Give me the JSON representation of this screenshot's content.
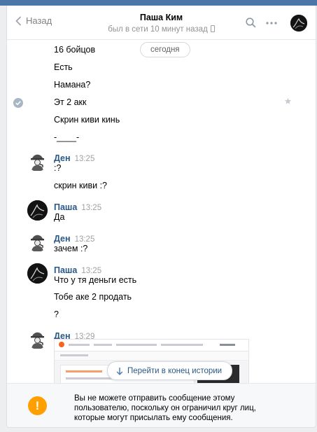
{
  "header": {
    "back_label": "Назад",
    "contact_name": "Паша Ким",
    "status": "был в сети 10 минут назад"
  },
  "date_separator": "сегодня",
  "messages": {
    "m1": "16 бойцов",
    "m2": "Есть",
    "m3": "Намана?",
    "m4": "Эт 2 акк",
    "m5": "Скрин киви кинь",
    "m6": "-____-",
    "g1": {
      "author": "Ден",
      "time": "13:25",
      "texts": [
        ":?",
        "скрин киви :?"
      ]
    },
    "g2": {
      "author": "Паша",
      "time": "13:25",
      "texts": [
        "Да"
      ]
    },
    "g3": {
      "author": "Ден",
      "time": "13:25",
      "texts": [
        "зачем :?"
      ]
    },
    "g4": {
      "author": "Паша",
      "time": "13:25",
      "texts": [
        "Что у тя деньги есть",
        "Тобе аке 2 продать",
        "?"
      ]
    },
    "g5": {
      "author": "Ден",
      "time": "13:29"
    }
  },
  "jump_to_end_label": "Перейти в конец истории",
  "footer": {
    "warning_symbol": "!",
    "notice": "Вы не можете отправить сообщение этому пользователю, поскольку он ограничил круг лиц, которые могут присылать ему сообщения."
  },
  "colors": {
    "accent": "#4a76a8",
    "author_link": "#2a5885",
    "warning": "#ffa000"
  },
  "icons": [
    "chevron-left-icon",
    "search-icon",
    "more-icon",
    "phone-icon",
    "read-check-icon",
    "star-icon",
    "arrow-down-icon",
    "warning-icon"
  ]
}
